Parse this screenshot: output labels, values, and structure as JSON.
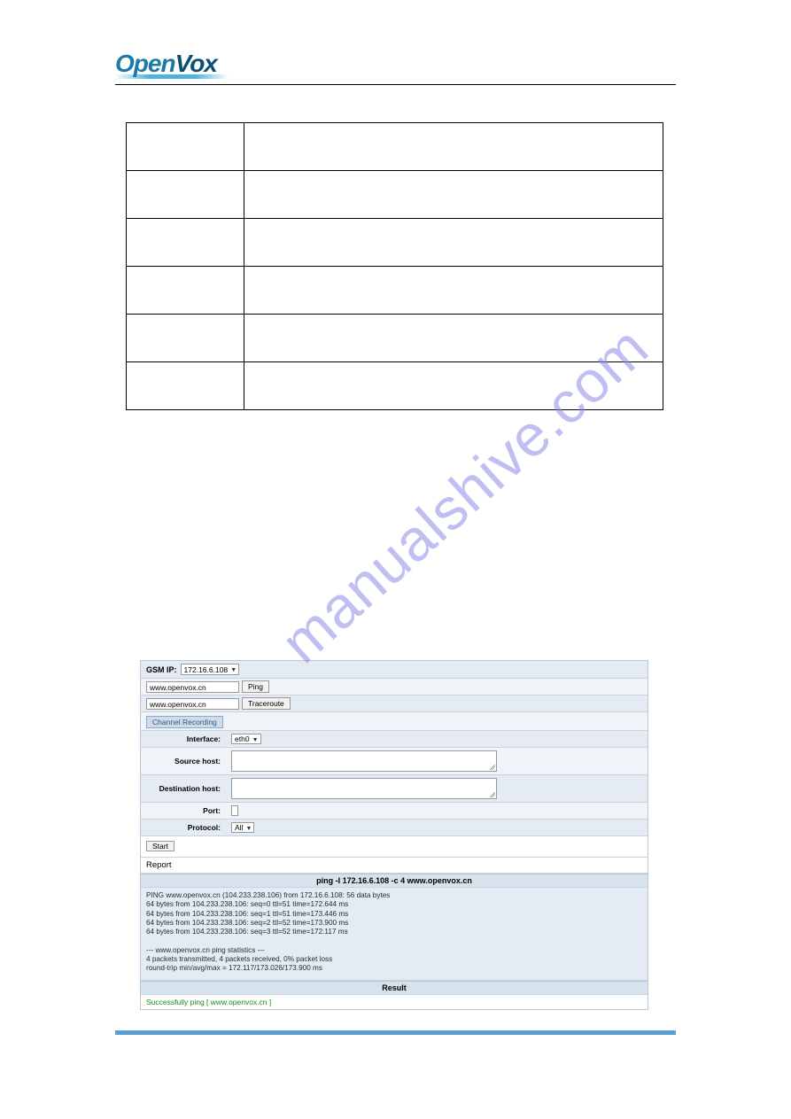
{
  "logo": {
    "left": "Open",
    "right": "Vox"
  },
  "watermark": "manualshive.com",
  "gsm": {
    "label": "GSM IP:",
    "ip": "172.16.6.108",
    "host1": "www.openvox.cn",
    "ping": "Ping",
    "host2": "www.openvox.cn",
    "traceroute": "Traceroute"
  },
  "section_tab": "Channel Recording",
  "form": {
    "interface_label": "Interface:",
    "interface_value": "eth0",
    "source_label": "Source host:",
    "dest_label": "Destination host:",
    "port_label": "Port:",
    "protocol_label": "Protocol:",
    "protocol_value": "All"
  },
  "start_btn": "Start",
  "report_label": "Report",
  "ping_title": "ping -I 172.16.6.108 -c 4 www.openvox.cn",
  "ping_output": "PING www.openvox.cn (104.233.238.106) from 172.16.6.108: 56 data bytes\n64 bytes from 104.233.238.106: seq=0 ttl=51 time=172.644 ms\n64 bytes from 104.233.238.106: seq=1 ttl=51 time=173.446 ms\n64 bytes from 104.233.238.106: seq=2 ttl=52 time=173.900 ms\n64 bytes from 104.233.238.106: seq=3 ttl=52 time=172.117 ms\n\n--- www.openvox.cn ping statistics ---\n4 packets transmitted, 4 packets received, 0% packet loss\nround-trip min/avg/max = 172.117/173.026/173.900 ms",
  "result_title": "Result",
  "result_text": "Successfully ping [ www.openvox.cn ]"
}
